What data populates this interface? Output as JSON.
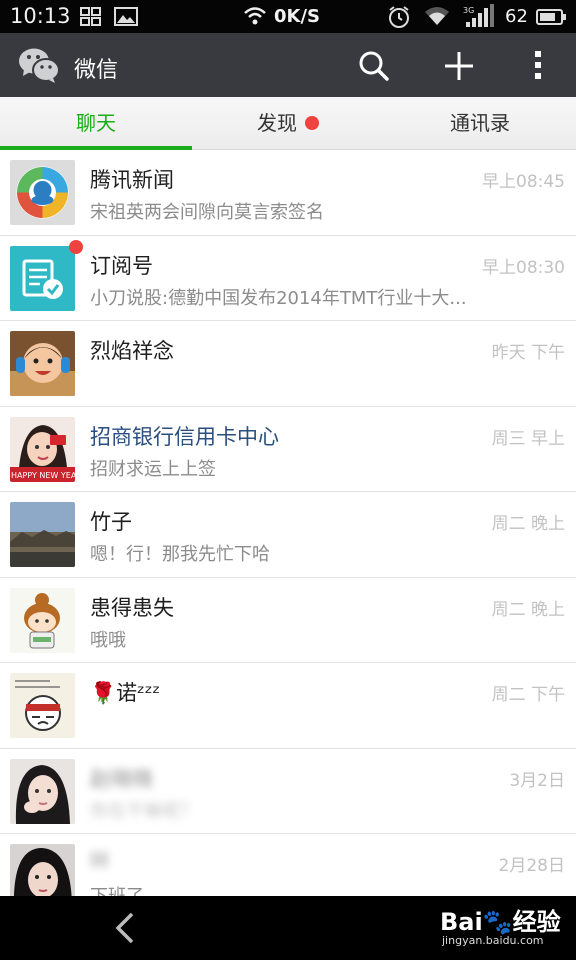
{
  "status_bar": {
    "time": "10:13",
    "speed": "0K/S",
    "battery": "62"
  },
  "action_bar": {
    "title": "微信",
    "icons": [
      "wechat-logo-icon",
      "search-icon",
      "plus-icon",
      "more-icon"
    ]
  },
  "tabs": [
    {
      "label": "聊天",
      "active": true
    },
    {
      "label": "发现",
      "has_dot": true
    },
    {
      "label": "通讯录"
    }
  ],
  "chats": [
    {
      "name": "腾讯新闻",
      "preview": "宋祖英两会间隙向莫言索签名",
      "time": "早上08:45"
    },
    {
      "name": "订阅号",
      "preview": "小刀说股:德勤中国发布2014年TMT行业十大...",
      "time": "早上08:30",
      "badge": true
    },
    {
      "name": "烈焰祥念",
      "preview": "",
      "time": "昨天 下午"
    },
    {
      "name": "招商银行信用卡中心",
      "preview": "招财求运上上签",
      "time": "周三 早上",
      "verified": true
    },
    {
      "name": "竹子",
      "preview": "嗯！行！那我先忙下哈",
      "time": "周二 晚上"
    },
    {
      "name": "患得患失",
      "preview": "哦哦",
      "time": "周二 晚上"
    },
    {
      "name": "🌹诺ᶻᶻᶻ",
      "preview": "",
      "time": "周二 下午"
    },
    {
      "name": "赵晓晓",
      "preview": "你在干嘛呢？",
      "time": "3月2日",
      "blurred": true
    },
    {
      "name": "III",
      "preview": "下班了",
      "time": "2月28日",
      "blurred": true
    }
  ],
  "watermark": {
    "main": "Bai🐾经验",
    "sub": "jingyan.baidu.com"
  },
  "colors": {
    "accent_green": "#1aad19",
    "action_bar": "#393a3f",
    "badge_red": "#f0423e"
  }
}
